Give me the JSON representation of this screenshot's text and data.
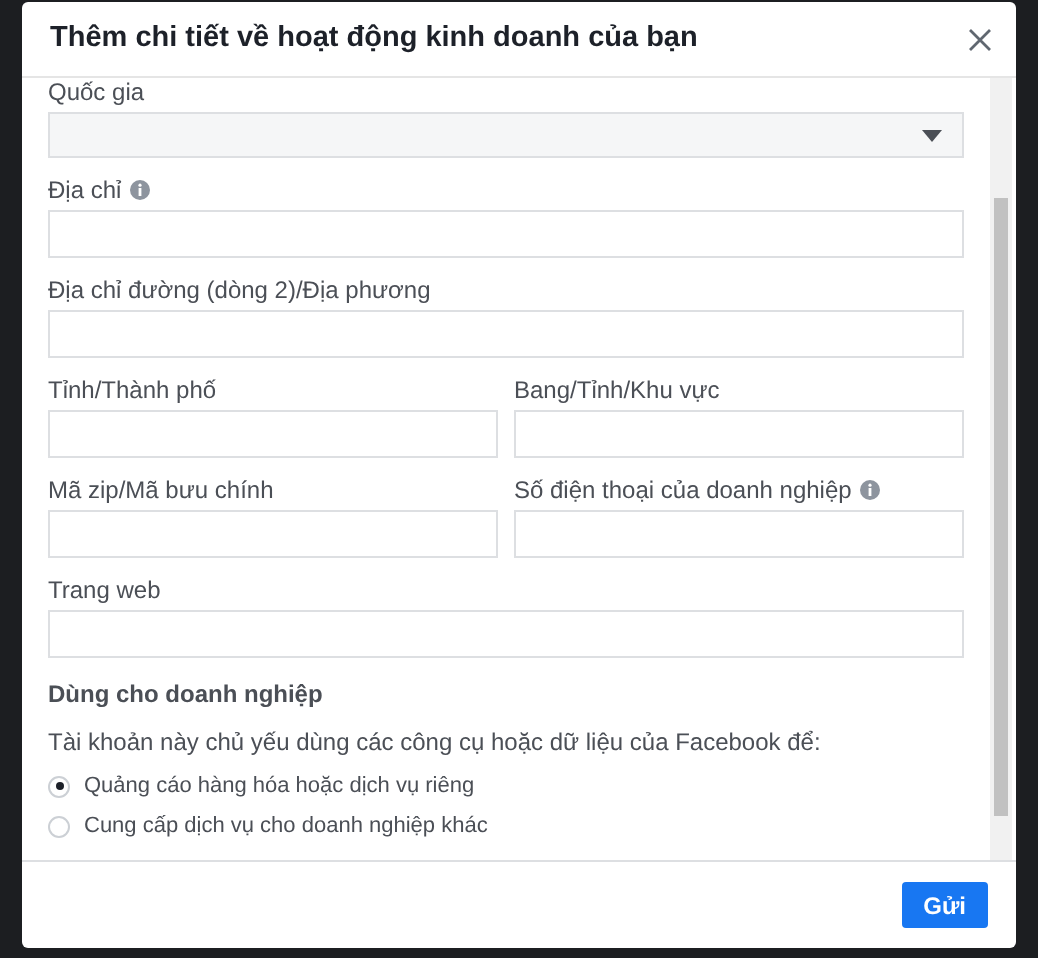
{
  "dialog": {
    "title": "Thêm chi tiết về hoạt động kinh doanh của bạn"
  },
  "form_rows": [
    [
      {
        "label": "Quốc gia",
        "kind": "select",
        "info": false
      }
    ],
    [
      {
        "label": "Địa chỉ",
        "kind": "text",
        "info": true
      }
    ],
    [
      {
        "label": "Địa chỉ đường (dòng 2)/Địa phương",
        "kind": "text",
        "info": false
      }
    ],
    [
      {
        "label": "Tỉnh/Thành phố",
        "kind": "text",
        "info": false
      },
      {
        "label": "Bang/Tỉnh/Khu vực",
        "kind": "text",
        "info": false
      }
    ],
    [
      {
        "label": "Mã zip/Mã bưu chính",
        "kind": "text",
        "info": false
      },
      {
        "label": "Số điện thoại của doanh nghiệp",
        "kind": "text",
        "info": true
      }
    ],
    [
      {
        "label": "Trang web",
        "kind": "text",
        "info": false
      }
    ]
  ],
  "business_use": {
    "heading": "Dùng cho doanh nghiệp",
    "question": "Tài khoản này chủ yếu dùng các công cụ hoặc dữ liệu của Facebook để:",
    "options": [
      {
        "label": "Quảng cáo hàng hóa hoặc dịch vụ riêng",
        "selected": true
      },
      {
        "label": "Cung cấp dịch vụ cho doanh nghiệp khác",
        "selected": false
      }
    ]
  },
  "buttons": [
    "Gửi"
  ]
}
